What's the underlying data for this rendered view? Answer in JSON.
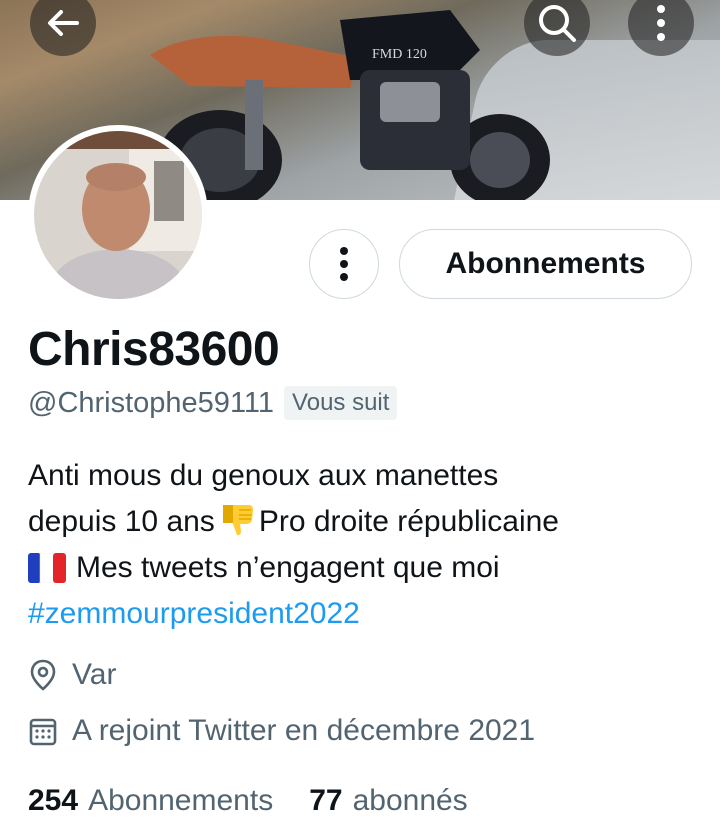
{
  "header": {
    "back_icon": "arrow-left-icon",
    "search_icon": "search-icon",
    "more_icon": "more-vertical-icon"
  },
  "banner": {
    "brand_text": "FMD 120"
  },
  "profile": {
    "display_name": "Chris83600",
    "handle": "@Christophe59111",
    "follows_you": "Vous suit",
    "bio_line1": "Anti mous du genoux aux manettes",
    "bio_line2_a": "depuis 10 ans",
    "bio_line2_b": "Pro droite républicaine",
    "bio_line3": "Mes tweets n’engagent que moi",
    "hashtag": "#zemmourpresident2022",
    "location": "Var",
    "joined": "A rejoint Twitter en décembre 2021"
  },
  "actions": {
    "follow_label": "Abonnements"
  },
  "stats": {
    "following_count": "254",
    "following_label": "Abonnements",
    "followers_count": "77",
    "followers_label": "abonnés"
  },
  "colors": {
    "accent": "#1d9bf0",
    "secondary_text": "#536471",
    "border": "#cfd9de"
  }
}
